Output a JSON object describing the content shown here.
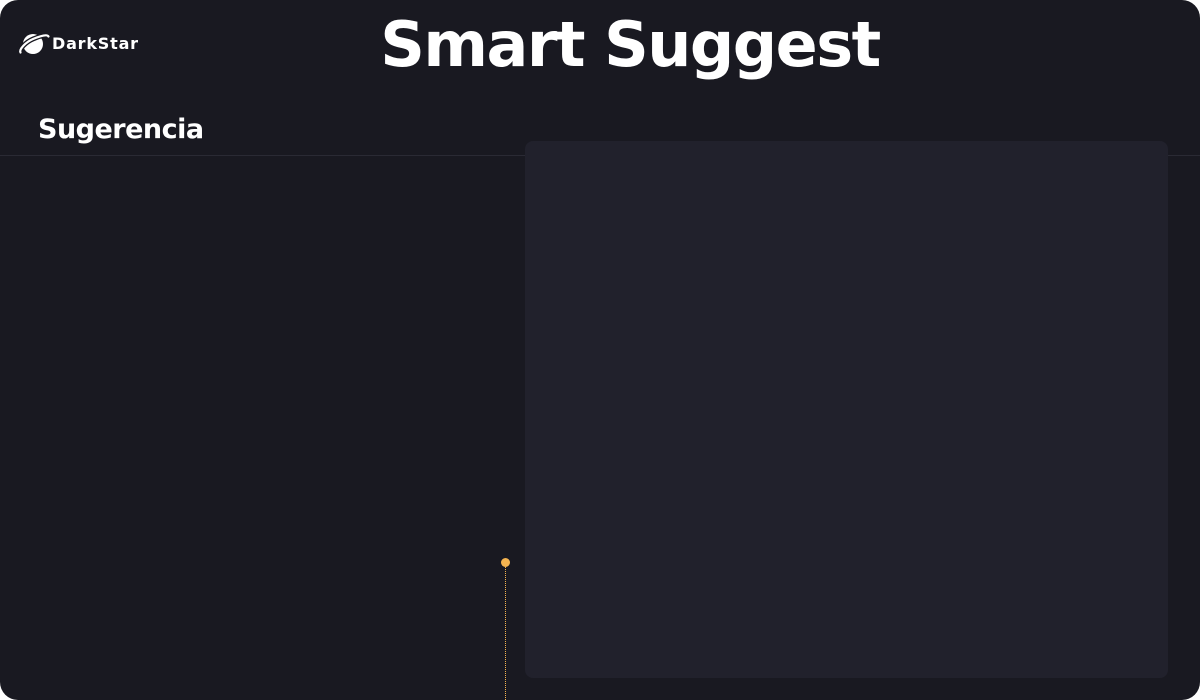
{
  "app": {
    "brand_name": "DarkStar",
    "logo_icon": "planet-icon"
  },
  "header": {
    "title": "Smart Suggest"
  },
  "section": {
    "heading": "Sugerencia"
  },
  "colors": {
    "background": "#191921",
    "panel": "#21212c",
    "divider": "#2a2a34",
    "text": "#ffffff",
    "accent": "#f5b450"
  }
}
